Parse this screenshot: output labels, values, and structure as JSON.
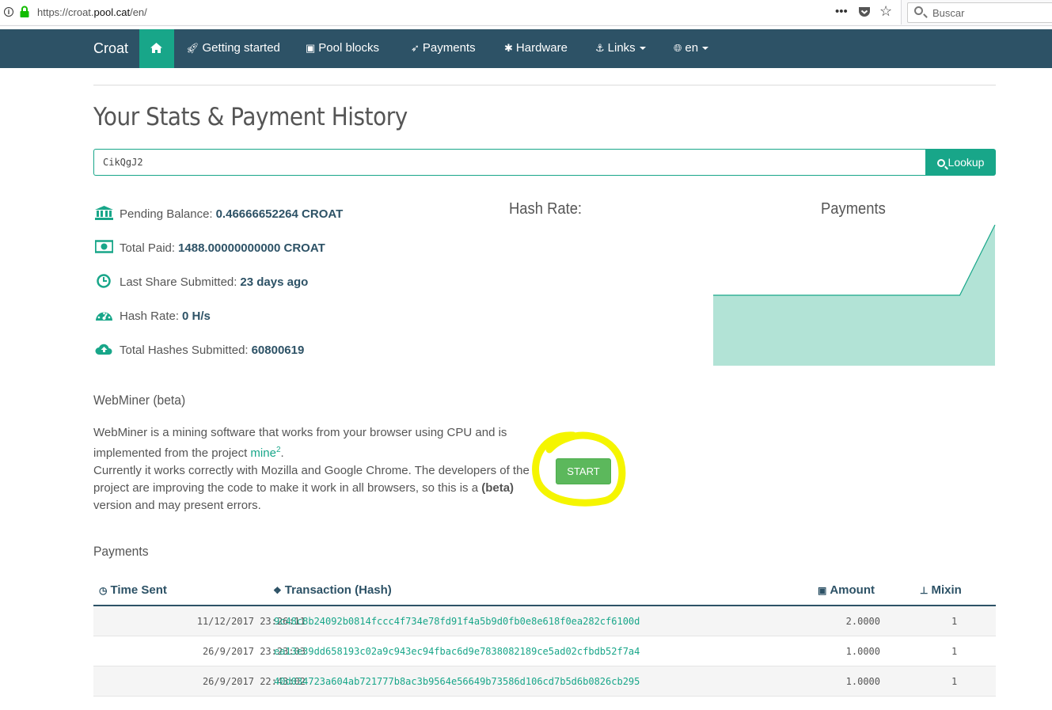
{
  "browser": {
    "url_prefix": "https://croat.",
    "url_domain": "pool.cat",
    "url_path": "/en/",
    "search_placeholder": "Buscar"
  },
  "nav": {
    "brand": "Croat",
    "items": [
      {
        "label": "Getting started",
        "icon": "rocket-icon"
      },
      {
        "label": "Pool blocks",
        "icon": "cubes-icon"
      },
      {
        "label": "Payments",
        "icon": "paper-plane-icon"
      },
      {
        "label": "Hardware",
        "icon": "bug-icon"
      },
      {
        "label": "Links",
        "icon": "anchor-icon"
      },
      {
        "label": "en",
        "icon": "globe-icon"
      }
    ]
  },
  "page": {
    "title": "Your Stats & Payment History"
  },
  "lookup": {
    "value": "CikQgJ2",
    "button": "Lookup"
  },
  "stats": [
    {
      "label": "Pending Balance:",
      "value": "0.46666652264 CROAT",
      "icon": "bank-icon"
    },
    {
      "label": "Total Paid:",
      "value": "1488.00000000000 CROAT",
      "icon": "money-icon"
    },
    {
      "label": "Last Share Submitted:",
      "value": "23 days ago",
      "icon": "clock-icon"
    },
    {
      "label": "Hash Rate:",
      "value": "0 H/s",
      "icon": "dashboard-icon"
    },
    {
      "label": "Total Hashes Submitted:",
      "value": "60800619",
      "icon": "cloud-upload-icon"
    }
  ],
  "charts": {
    "hash_title": "Hash Rate:",
    "payments_title": "Payments"
  },
  "chart_data": {
    "type": "area",
    "title": "Payments",
    "series": [
      {
        "values": [
          1,
          1,
          1,
          1,
          1,
          1,
          1,
          1,
          2
        ]
      }
    ],
    "ylim": [
      0,
      2
    ],
    "grid": false,
    "color": "#b2e3d6",
    "line_color": "#18a689"
  },
  "webminer": {
    "title": "WebMiner (beta)",
    "text1": "WebMiner is a mining software that works from your browser using CPU and is implemented from the project ",
    "link": "mine",
    "link_sup": "2",
    "text2": ".",
    "text3": "Currently it works correctly with Mozilla and Google Chrome. The developers of the project are improving the code to make it work in all browsers, so this is a ",
    "beta": "(beta)",
    "text4": " version and may present errors.",
    "start_button": "START",
    "highlight_color": "#f5f500"
  },
  "payments": {
    "heading": "Payments",
    "columns": [
      "Time Sent",
      "Transaction (Hash)",
      "Amount",
      "Mixin"
    ],
    "rows": [
      {
        "time": "11/12/2017 23:26:11",
        "hash": "9c48c8b24092b0814fccc4f734e78fd91f4a5b9d0fb0e8e618f0ea282cf6100d",
        "amount": "2.0000",
        "mixin": "1"
      },
      {
        "time": "26/9/2017 23:23:03",
        "hash": "ea13e39dd658193c02a9c943ec94fbac6d9e7838082189ce5ad02cfbdb52f7a4",
        "amount": "1.0000",
        "mixin": "1"
      },
      {
        "time": "26/9/2017 22:43:02",
        "hash": "40d034723a604ab721777b8ac3b9564e56649b73586d106cd7b5d6b0826cb295",
        "amount": "1.0000",
        "mixin": "1"
      }
    ]
  },
  "colors": {
    "navbar": "#2d5266",
    "accent": "#18a689",
    "start_button": "#5cb85c"
  }
}
